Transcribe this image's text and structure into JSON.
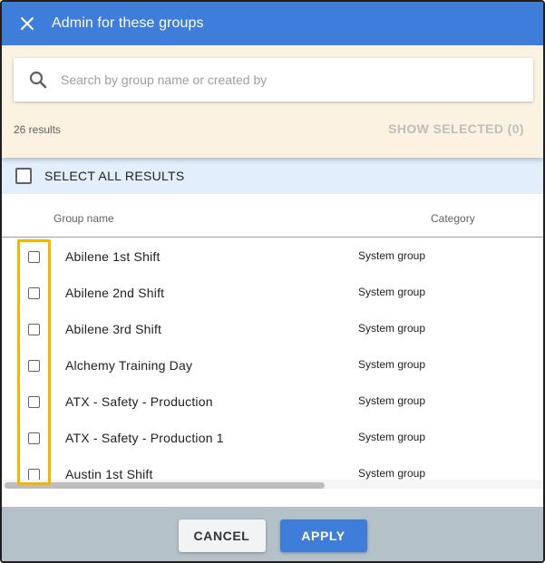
{
  "dialog": {
    "title": "Admin for these groups"
  },
  "search": {
    "placeholder": "Search by group name or created by",
    "value": ""
  },
  "results": {
    "count_label": "26 results",
    "show_selected_label": "SHOW SELECTED (0)"
  },
  "select_all": {
    "label": "SELECT ALL RESULTS",
    "checked": false
  },
  "table": {
    "columns": {
      "name": "Group name",
      "category": "Category"
    },
    "rows": [
      {
        "name": "Abilene 1st Shift",
        "category": "System group",
        "checked": false
      },
      {
        "name": "Abilene 2nd Shift",
        "category": "System group",
        "checked": false
      },
      {
        "name": "Abilene 3rd Shift",
        "category": "System group",
        "checked": false
      },
      {
        "name": "Alchemy Training Day",
        "category": "System group",
        "checked": false
      },
      {
        "name": "ATX - Safety - Production",
        "category": "System group",
        "checked": false
      },
      {
        "name": "ATX - Safety - Production 1",
        "category": "System group",
        "checked": false
      },
      {
        "name": "Austin 1st Shift",
        "category": "System group",
        "checked": false
      }
    ]
  },
  "footer": {
    "cancel_label": "CANCEL",
    "apply_label": "APPLY"
  },
  "colors": {
    "header_bg": "#3f7ddb",
    "search_panel_bg": "#fcf2e1",
    "select_all_bg": "#e2eefb",
    "highlight": "#f5b400",
    "footer_bg": "#b5c1c8",
    "apply_bg": "#3f7ddb"
  },
  "icons": {
    "close": "close-icon",
    "search": "search-icon"
  }
}
